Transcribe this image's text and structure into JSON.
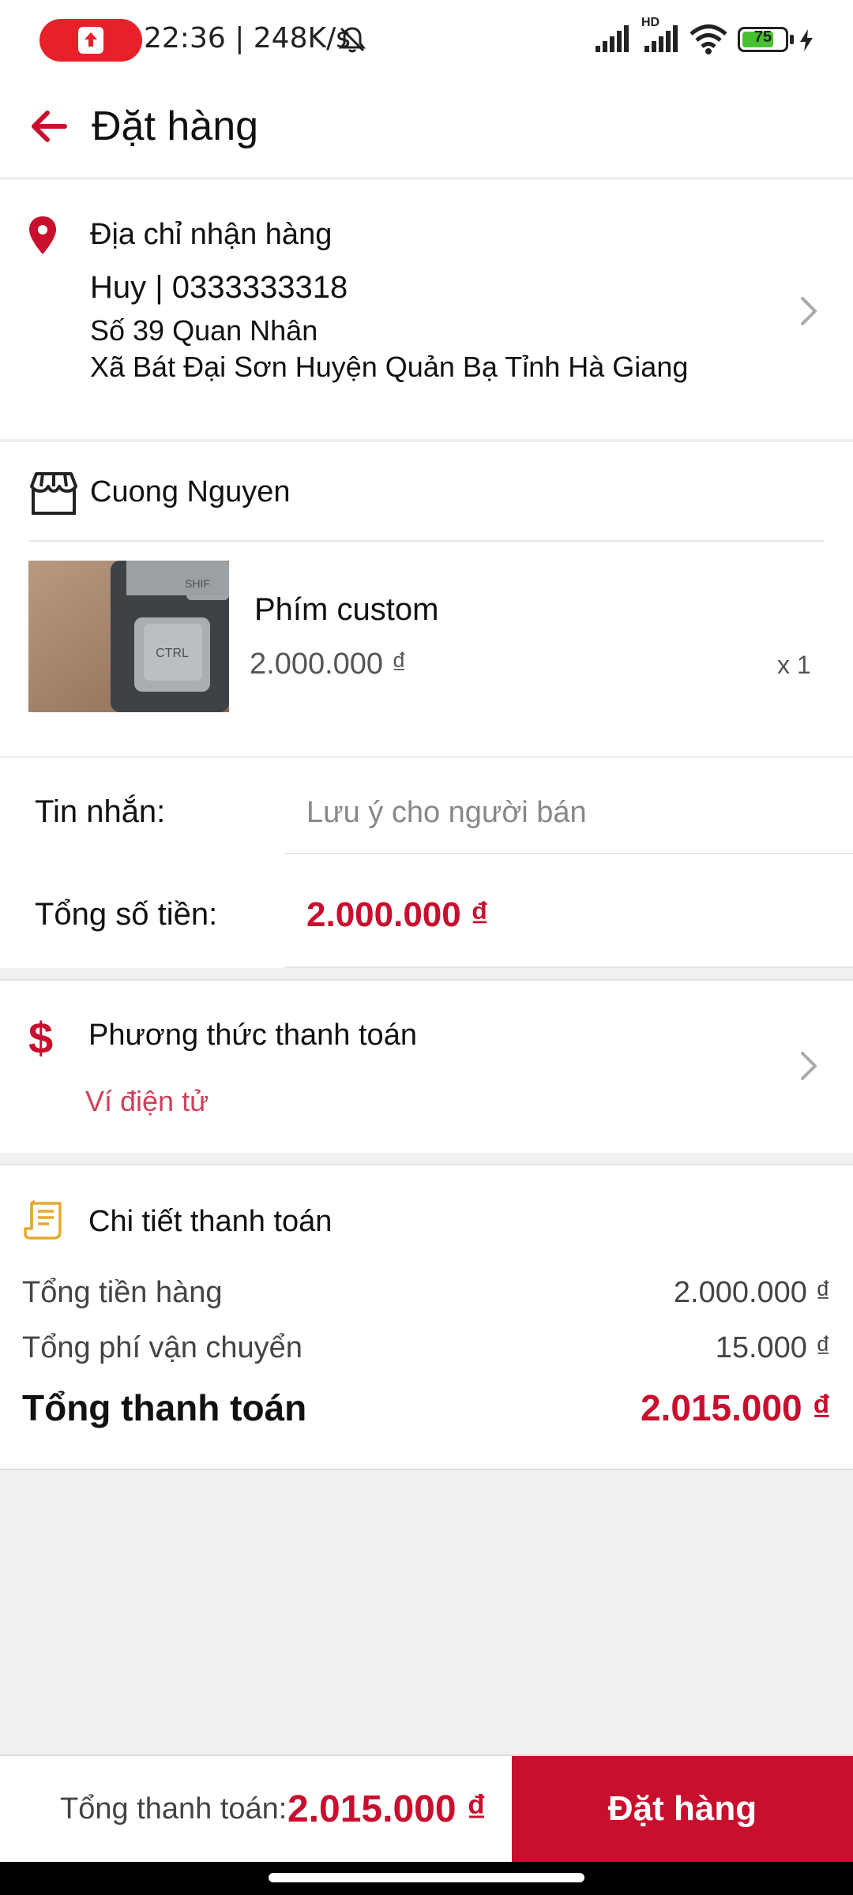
{
  "status_bar": {
    "time_speed": "22:36 | 248K/s",
    "network_label": "HD",
    "battery_level": "75",
    "battery_fraction": 0.75
  },
  "header": {
    "title": "Đặt hàng"
  },
  "address": {
    "title": "Địa chỉ nhận hàng",
    "name_phone": "Huy | 0333333318",
    "line1": "Số 39 Quan Nhân",
    "line2": "Xã Bát Đại Sơn Huyện Quản Bạ Tỉnh Hà Giang"
  },
  "shop": {
    "name": "Cuong Nguyen",
    "product": {
      "name": "Phím custom",
      "price": "2.000.000 ₫",
      "quantity": "x 1",
      "image_text": [
        "SHIF",
        "CTRL"
      ]
    }
  },
  "message": {
    "label": "Tin nhắn:",
    "placeholder": "Lưu ý cho người bán"
  },
  "order_total": {
    "label": "Tổng số tiền:",
    "value": "2.000.000 ₫"
  },
  "payment_method": {
    "title": "Phương thức thanh toán",
    "icon": "$",
    "value": "Ví điện tử"
  },
  "payment_details": {
    "title": "Chi tiết thanh toán",
    "rows": [
      {
        "label": "Tổng tiền hàng",
        "value": "2.000.000 ₫"
      },
      {
        "label": "Tổng phí vận chuyển",
        "value": "15.000 ₫"
      },
      {
        "label": "Tổng thanh toán",
        "value": "2.015.000 ₫"
      }
    ]
  },
  "bottom_bar": {
    "label": "Tổng thanh toán:",
    "total": "2.015.000 ₫",
    "button_label": "Đặt hàng"
  },
  "colors": {
    "accent": "#c8102e",
    "payment_value": "#d0405a",
    "receipt_icon": "#e6a92c"
  }
}
